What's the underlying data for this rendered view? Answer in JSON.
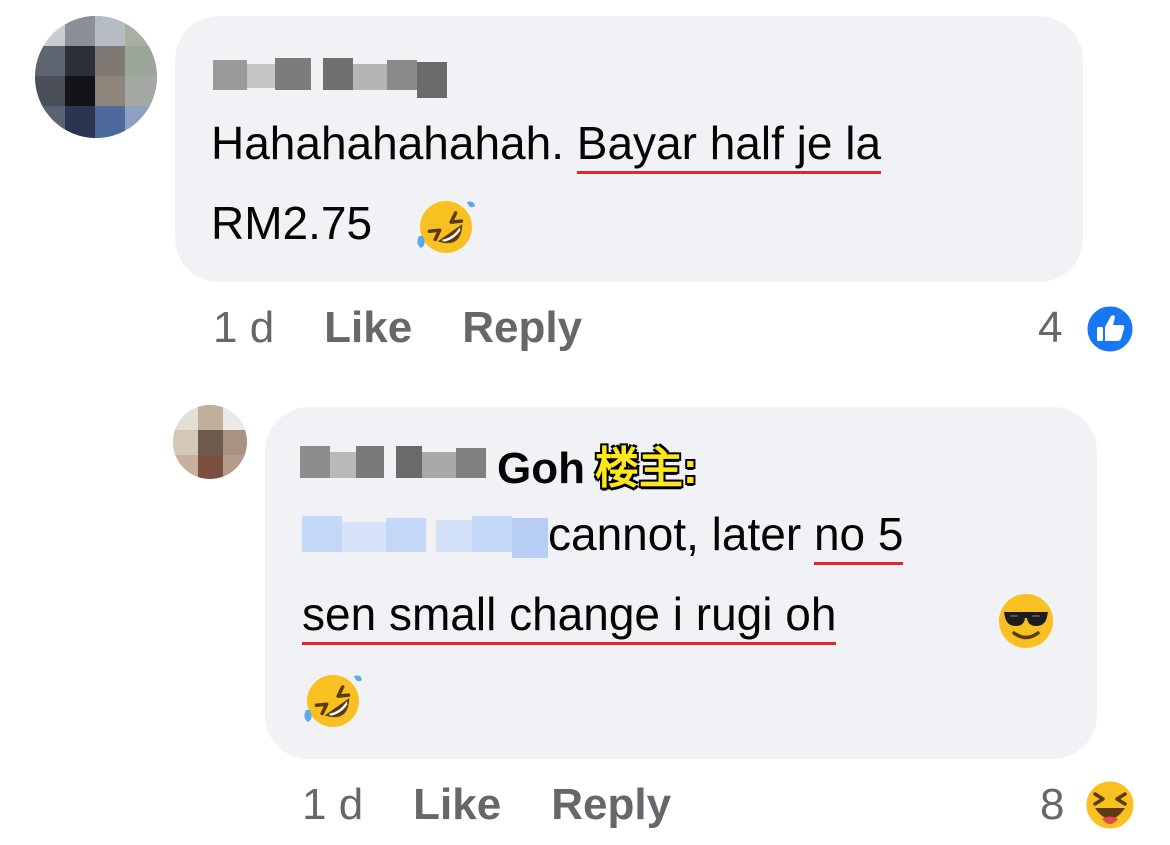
{
  "comment1": {
    "text_plain": "Hahahahahahah. ",
    "text_underlined_1": "Bayar half je la",
    "text_line2": "RM2.75",
    "emoji_1": "rolling-on-floor-laughing-emoji",
    "time": "1 d",
    "like_label": "Like",
    "reply_label": "Reply",
    "reaction_count": "4",
    "reaction_icon": "like-thumb-icon"
  },
  "comment2": {
    "author_visible_part": "Goh",
    "author_tag": "楼主:",
    "text_after_mention": " cannot, later ",
    "text_underlined_1": "no 5",
    "text_underlined_2": "sen small change i rugi oh",
    "emoji_1": "smiling-face-with-sunglasses-emoji",
    "emoji_2": "rolling-on-floor-laughing-emoji",
    "time": "1 d",
    "like_label": "Like",
    "reply_label": "Reply",
    "reaction_count": "8",
    "reaction_icon": "haha-reaction-icon"
  },
  "colors": {
    "bubble": "#f0f2f5",
    "meta_text": "#65676b",
    "underline": "#e0262b",
    "like_blue": "#1877f2",
    "tag_yellow": "#ffe81a"
  }
}
